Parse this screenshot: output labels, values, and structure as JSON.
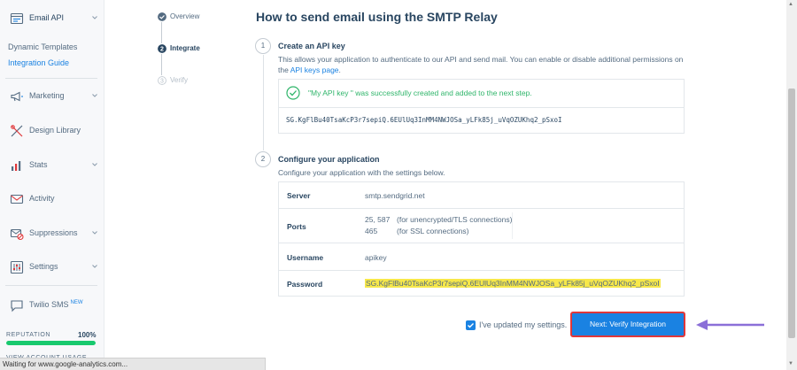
{
  "sidebar": {
    "header": {
      "label": "Email API",
      "icon": "email-api-icon"
    },
    "sub_links": [
      {
        "label": "Dynamic Templates",
        "active": false
      },
      {
        "label": "Integration Guide",
        "active": true
      }
    ],
    "items": [
      {
        "label": "Marketing",
        "icon": "megaphone-icon",
        "chevron": true
      },
      {
        "label": "Design Library",
        "icon": "design-library-icon",
        "chevron": false
      },
      {
        "label": "Stats",
        "icon": "stats-icon",
        "chevron": true
      },
      {
        "label": "Activity",
        "icon": "activity-icon",
        "chevron": false
      },
      {
        "label": "Suppressions",
        "icon": "suppressions-icon",
        "chevron": true
      },
      {
        "label": "Settings",
        "icon": "settings-icon",
        "chevron": true
      },
      {
        "label": "Twilio SMS",
        "icon": "sms-icon",
        "badge": "NEW"
      }
    ],
    "reputation": {
      "label": "REPUTATION",
      "value": "100%",
      "percent": 100
    },
    "view_usage": "VIEW ACCOUNT USAGE"
  },
  "stepper": [
    {
      "label": "Overview",
      "state": "done"
    },
    {
      "label": "Integrate",
      "state": "current"
    },
    {
      "label": "Verify",
      "state": "pending"
    }
  ],
  "main": {
    "title": "How to send email using the SMTP Relay",
    "step1": {
      "number": "1",
      "title": "Create an API key",
      "desc_prefix": "This allows your application to authenticate to our API and send mail. You can enable or disable additional permissions on the ",
      "desc_link": "API keys page",
      "desc_suffix": ".",
      "success_msg": "\"My API key \" was successfully created and added to the next step.",
      "api_key": "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"
    },
    "step2": {
      "number": "2",
      "title": "Configure your application",
      "desc": "Configure your application with the settings below.",
      "rows": {
        "server": {
          "key": "Server",
          "value": "smtp.sendgrid.net"
        },
        "ports": {
          "key": "Ports",
          "lines": [
            {
              "port": "25, 587",
              "note": "(for unencrypted/TLS connections)"
            },
            {
              "port": "465",
              "note": "(for SSL connections)"
            }
          ]
        },
        "username": {
          "key": "Username",
          "value": "apikey"
        },
        "password": {
          "key": "Password",
          "value": "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"
        }
      }
    },
    "confirm_checkbox": {
      "label": "I've updated my settings.",
      "checked": true
    },
    "verify_button": "Next: Verify Integration"
  },
  "status_bar": "Waiting for www.google-analytics.com...",
  "colors": {
    "accent": "#1a82e2",
    "success": "#2fb56a",
    "highlight": "#f7e84a",
    "annotation_arrow": "#8b6fd8",
    "annotation_border": "#e0373a"
  }
}
